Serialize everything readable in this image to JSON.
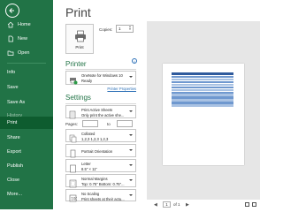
{
  "sidebar": {
    "items": [
      {
        "label": "Home"
      },
      {
        "label": "New"
      },
      {
        "label": "Open"
      },
      {
        "label": "Info"
      },
      {
        "label": "Save"
      },
      {
        "label": "Save As"
      },
      {
        "label": "History"
      },
      {
        "label": "Print"
      },
      {
        "label": "Share"
      },
      {
        "label": "Export"
      },
      {
        "label": "Publish"
      },
      {
        "label": "Close"
      },
      {
        "label": "More..."
      }
    ]
  },
  "main": {
    "title": "Print",
    "print_button": "Print",
    "copies_label": "Copies:",
    "copies_value": "1",
    "printer": {
      "heading": "Printer",
      "name": "OneNote for Windows 10",
      "status": "Ready",
      "properties_link": "Printer Properties"
    },
    "settings": {
      "heading": "Settings",
      "what": {
        "line1": "Print Active Sheets",
        "line2": "Only print the active she..."
      },
      "pages_label": "Pages:",
      "to_label": "to",
      "collate": {
        "line1": "Collated",
        "line2": "1,2,3   1,2,3   1,2,3"
      },
      "orientation": {
        "line1": "Portrait Orientation"
      },
      "paper": {
        "line1": "Letter",
        "line2": "8.5\" × 11\""
      },
      "margins": {
        "line1": "Normal Margins",
        "line2": "Top: 0.75\" Bottom: 0.75\"..."
      },
      "scaling": {
        "line1": "No Scaling",
        "line2": "Print sheets at their actu..."
      }
    },
    "pager": {
      "current": "1",
      "of_text": "of 1",
      "prev": "◀",
      "next": "▶"
    }
  },
  "colors": {
    "accent": "#217346",
    "active_nav": "#0e5c2f",
    "link": "#2b6fb6"
  }
}
